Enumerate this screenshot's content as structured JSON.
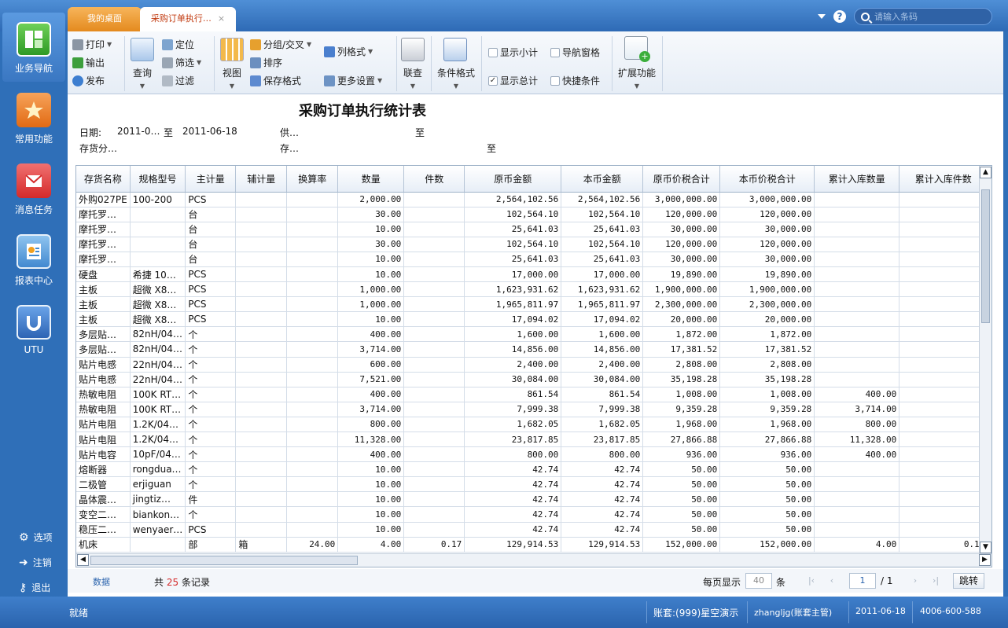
{
  "tabs": {
    "desktop_label": "我的桌面",
    "active_label": "采购订单执行…",
    "close_glyph": "×"
  },
  "search": {
    "placeholder": "请输入条码"
  },
  "sidenav": {
    "items": [
      {
        "label": "业务导航",
        "icon": "business-nav-icon"
      },
      {
        "label": "常用功能",
        "icon": "star-icon"
      },
      {
        "label": "消息任务",
        "icon": "message-icon"
      },
      {
        "label": "报表中心",
        "icon": "report-icon"
      },
      {
        "label": "UTU",
        "icon": "utu-icon"
      }
    ],
    "bottom": {
      "options": "选项",
      "logout": "注销",
      "exit": "退出"
    }
  },
  "toolbar": {
    "print": "打印",
    "export": "输出",
    "publish": "发布",
    "query": "查询",
    "locate": "定位",
    "filter": "筛选",
    "refine": "过滤",
    "view": "视图",
    "group_cross": "分组/交叉",
    "sort": "排序",
    "save_format": "保存格式",
    "column_format": "列格式",
    "more_settings": "更多设置",
    "link_query": "联查",
    "cond_format": "条件格式",
    "show_subtotal": "显示小计",
    "nav_pane": "导航窗格",
    "show_total": "显示总计",
    "quick_cond": "快捷条件",
    "extend": "扩展功能",
    "show_subtotal_checked": false,
    "nav_pane_checked": false,
    "show_total_checked": true,
    "quick_cond_checked": false
  },
  "report": {
    "title": "采购订单执行统计表",
    "date_label": "日期:",
    "date_from": "2011-0…",
    "to1": "至",
    "date_to": "2011-06-18",
    "supplier_label": "供…",
    "to2": "至",
    "inv_class_label": "存货分…",
    "inv_label": "存…",
    "to3": "至"
  },
  "grid": {
    "columns": [
      "存货名称",
      "规格型号",
      "主计量",
      "辅计量",
      "换算率",
      "数量",
      "件数",
      "原币金额",
      "本币金额",
      "原币价税合计",
      "本币价税合计",
      "累计入库数量",
      "累计入库件数"
    ],
    "rows": [
      [
        "外购027PE",
        "100-200",
        "PCS",
        "",
        "",
        "2,000.00",
        "",
        "2,564,102.56",
        "2,564,102.56",
        "3,000,000.00",
        "3,000,000.00",
        "",
        ""
      ],
      [
        "摩托罗…",
        "",
        "台",
        "",
        "",
        "30.00",
        "",
        "102,564.10",
        "102,564.10",
        "120,000.00",
        "120,000.00",
        "",
        ""
      ],
      [
        "摩托罗…",
        "",
        "台",
        "",
        "",
        "10.00",
        "",
        "25,641.03",
        "25,641.03",
        "30,000.00",
        "30,000.00",
        "",
        ""
      ],
      [
        "摩托罗…",
        "",
        "台",
        "",
        "",
        "30.00",
        "",
        "102,564.10",
        "102,564.10",
        "120,000.00",
        "120,000.00",
        "",
        ""
      ],
      [
        "摩托罗…",
        "",
        "台",
        "",
        "",
        "10.00",
        "",
        "25,641.03",
        "25,641.03",
        "30,000.00",
        "30,000.00",
        "",
        ""
      ],
      [
        "硬盘",
        "希捷 10…",
        "PCS",
        "",
        "",
        "10.00",
        "",
        "17,000.00",
        "17,000.00",
        "19,890.00",
        "19,890.00",
        "",
        ""
      ],
      [
        "主板",
        "超微 X8…",
        "PCS",
        "",
        "",
        "1,000.00",
        "",
        "1,623,931.62",
        "1,623,931.62",
        "1,900,000.00",
        "1,900,000.00",
        "",
        ""
      ],
      [
        "主板",
        "超微 X8…",
        "PCS",
        "",
        "",
        "1,000.00",
        "",
        "1,965,811.97",
        "1,965,811.97",
        "2,300,000.00",
        "2,300,000.00",
        "",
        ""
      ],
      [
        "主板",
        "超微 X8…",
        "PCS",
        "",
        "",
        "10.00",
        "",
        "17,094.02",
        "17,094.02",
        "20,000.00",
        "20,000.00",
        "",
        ""
      ],
      [
        "多层贴…",
        "82nH/04…",
        "个",
        "",
        "",
        "400.00",
        "",
        "1,600.00",
        "1,600.00",
        "1,872.00",
        "1,872.00",
        "",
        ""
      ],
      [
        "多层贴…",
        "82nH/04…",
        "个",
        "",
        "",
        "3,714.00",
        "",
        "14,856.00",
        "14,856.00",
        "17,381.52",
        "17,381.52",
        "",
        ""
      ],
      [
        "贴片电感",
        "22nH/04…",
        "个",
        "",
        "",
        "600.00",
        "",
        "2,400.00",
        "2,400.00",
        "2,808.00",
        "2,808.00",
        "",
        ""
      ],
      [
        "贴片电感",
        "22nH/04…",
        "个",
        "",
        "",
        "7,521.00",
        "",
        "30,084.00",
        "30,084.00",
        "35,198.28",
        "35,198.28",
        "",
        ""
      ],
      [
        "热敏电阻",
        "100K RT…",
        "个",
        "",
        "",
        "400.00",
        "",
        "861.54",
        "861.54",
        "1,008.00",
        "1,008.00",
        "400.00",
        ""
      ],
      [
        "热敏电阻",
        "100K RT…",
        "个",
        "",
        "",
        "3,714.00",
        "",
        "7,999.38",
        "7,999.38",
        "9,359.28",
        "9,359.28",
        "3,714.00",
        ""
      ],
      [
        "贴片电阻",
        "1.2K/04…",
        "个",
        "",
        "",
        "800.00",
        "",
        "1,682.05",
        "1,682.05",
        "1,968.00",
        "1,968.00",
        "800.00",
        ""
      ],
      [
        "贴片电阻",
        "1.2K/04…",
        "个",
        "",
        "",
        "11,328.00",
        "",
        "23,817.85",
        "23,817.85",
        "27,866.88",
        "27,866.88",
        "11,328.00",
        ""
      ],
      [
        "贴片电容",
        "10pF/04…",
        "个",
        "",
        "",
        "400.00",
        "",
        "800.00",
        "800.00",
        "936.00",
        "936.00",
        "400.00",
        ""
      ],
      [
        "熔断器",
        "rongdua…",
        "个",
        "",
        "",
        "10.00",
        "",
        "42.74",
        "42.74",
        "50.00",
        "50.00",
        "",
        ""
      ],
      [
        "二极管",
        "erjiguan",
        "个",
        "",
        "",
        "10.00",
        "",
        "42.74",
        "42.74",
        "50.00",
        "50.00",
        "",
        ""
      ],
      [
        "晶体震…",
        "jingtiz…",
        "件",
        "",
        "",
        "10.00",
        "",
        "42.74",
        "42.74",
        "50.00",
        "50.00",
        "",
        ""
      ],
      [
        "变空二…",
        "biankon…",
        "个",
        "",
        "",
        "10.00",
        "",
        "42.74",
        "42.74",
        "50.00",
        "50.00",
        "",
        ""
      ],
      [
        "稳压二…",
        "wenyaer…",
        "PCS",
        "",
        "",
        "10.00",
        "",
        "42.74",
        "42.74",
        "50.00",
        "50.00",
        "",
        ""
      ],
      [
        "机床",
        "",
        "部",
        "箱",
        "24.00",
        "4.00",
        "0.17",
        "129,914.53",
        "129,914.53",
        "152,000.00",
        "152,000.00",
        "4.00",
        "0.17"
      ]
    ]
  },
  "footer": {
    "data_link": "数据",
    "total_prefix": "共",
    "total_count": "25",
    "total_suffix": "条记录",
    "per_page_label": "每页显示",
    "per_page_value": "40",
    "per_page_unit": "条",
    "page_current": "1",
    "page_sep": "/",
    "page_total": "1",
    "jump": "跳转"
  },
  "status": {
    "ready": "就绪",
    "account": "账套:(999)星空演示",
    "user": "zhangljg(账套主管)",
    "date": "2011-06-18",
    "phone": "4006-600-588"
  }
}
